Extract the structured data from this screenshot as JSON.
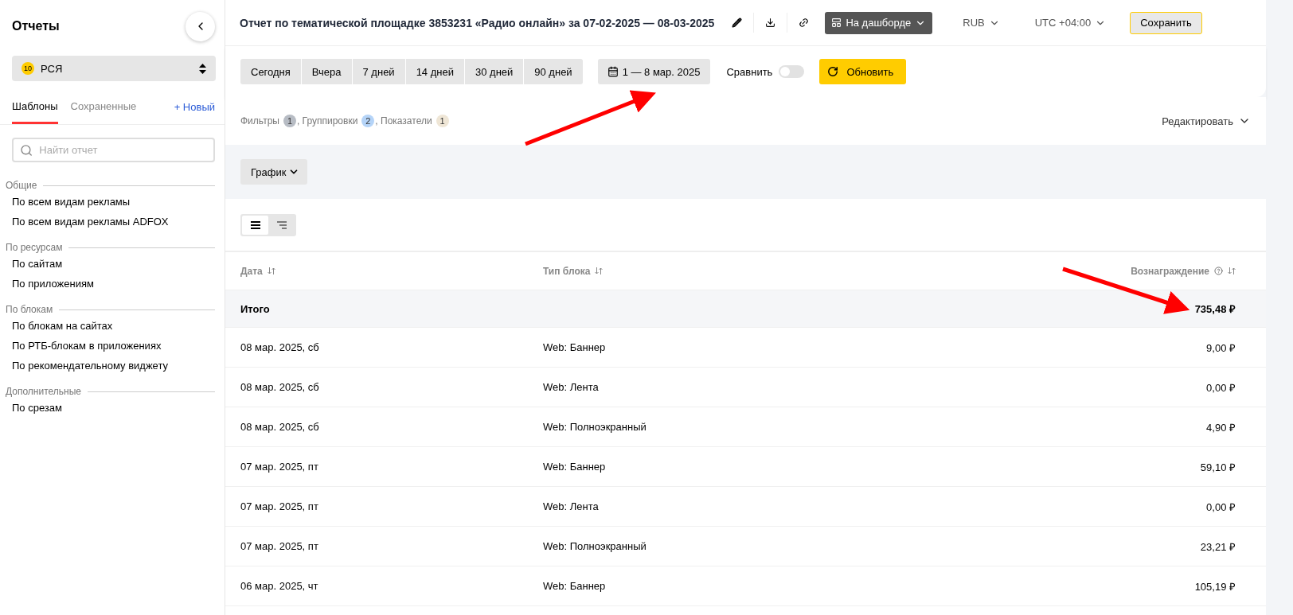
{
  "sidebar": {
    "title": "Отчеты",
    "source": {
      "badge": "10",
      "label": "РСЯ"
    },
    "tabs": [
      {
        "label": "Шаблоны",
        "selected": true
      },
      {
        "label": "Сохраненные",
        "selected": false
      }
    ],
    "new_link": "+ Новый",
    "search": {
      "placeholder": "Найти отчет"
    },
    "groups": [
      {
        "title": "Общие",
        "items": [
          "По всем видам рекламы",
          "По всем видам рекламы ADFOX"
        ]
      },
      {
        "title": "По ресурсам",
        "items": [
          "По сайтам",
          "По приложениям"
        ]
      },
      {
        "title": "По блокам",
        "items": [
          "По блокам на сайтах",
          "По РТБ-блокам в приложениях",
          "По рекомендательному виджету"
        ]
      },
      {
        "title": "Дополнительные",
        "items": [
          "По срезам"
        ]
      }
    ]
  },
  "header": {
    "title": "Отчет по тематической площадке 3853231 «Радио онлайн» за 07-02-2025 — 08-03-2025",
    "dashboard": "На дашборде",
    "currency": "RUB",
    "timezone": "UTC +04:00",
    "save": "Сохранить"
  },
  "periods": [
    {
      "label": "Сегодня",
      "selected": false
    },
    {
      "label": "Вчера",
      "selected": false
    },
    {
      "label": "7 дней",
      "selected": false
    },
    {
      "label": "14 дней",
      "selected": false
    },
    {
      "label": "30 дней",
      "selected": false
    },
    {
      "label": "90 дней",
      "selected": false
    }
  ],
  "date_range": "1 — 8 мар. 2025",
  "compare": {
    "label": "Сравнить",
    "on": false
  },
  "refresh": "Обновить",
  "summary": [
    {
      "label": "Фильтры",
      "count": "1",
      "color": "#b7bcc4"
    },
    {
      "label": ", Группировки",
      "count": "2",
      "color": "#b5d4f8"
    },
    {
      "label": ", Показатели",
      "count": "1",
      "color": "#efe6d6"
    }
  ],
  "edit": "Редактировать",
  "chart_button": "График",
  "view_toggle": [
    {
      "kind": "flat",
      "selected": true
    },
    {
      "kind": "tree",
      "selected": false
    }
  ],
  "table": {
    "columns": [
      {
        "label": "Дата",
        "help": false
      },
      {
        "label": "Тип блока",
        "help": false
      },
      {
        "label": "Вознаграждение",
        "help": true
      }
    ],
    "total": {
      "label": "Итого",
      "value": "735,48 ₽"
    },
    "rows": [
      [
        "08 мар. 2025, сб",
        "Web: Баннер",
        "9,00 ₽"
      ],
      [
        "08 мар. 2025, сб",
        "Web: Лента",
        "0,00 ₽"
      ],
      [
        "08 мар. 2025, сб",
        "Web: Полноэкранный",
        "4,90 ₽"
      ],
      [
        "07 мар. 2025, пт",
        "Web: Баннер",
        "59,10 ₽"
      ],
      [
        "07 мар. 2025, пт",
        "Web: Лента",
        "0,00 ₽"
      ],
      [
        "07 мар. 2025, пт",
        "Web: Полноэкранный",
        "23,21 ₽"
      ],
      [
        "06 мар. 2025, чт",
        "Web: Баннер",
        "105,19 ₽"
      ]
    ]
  }
}
